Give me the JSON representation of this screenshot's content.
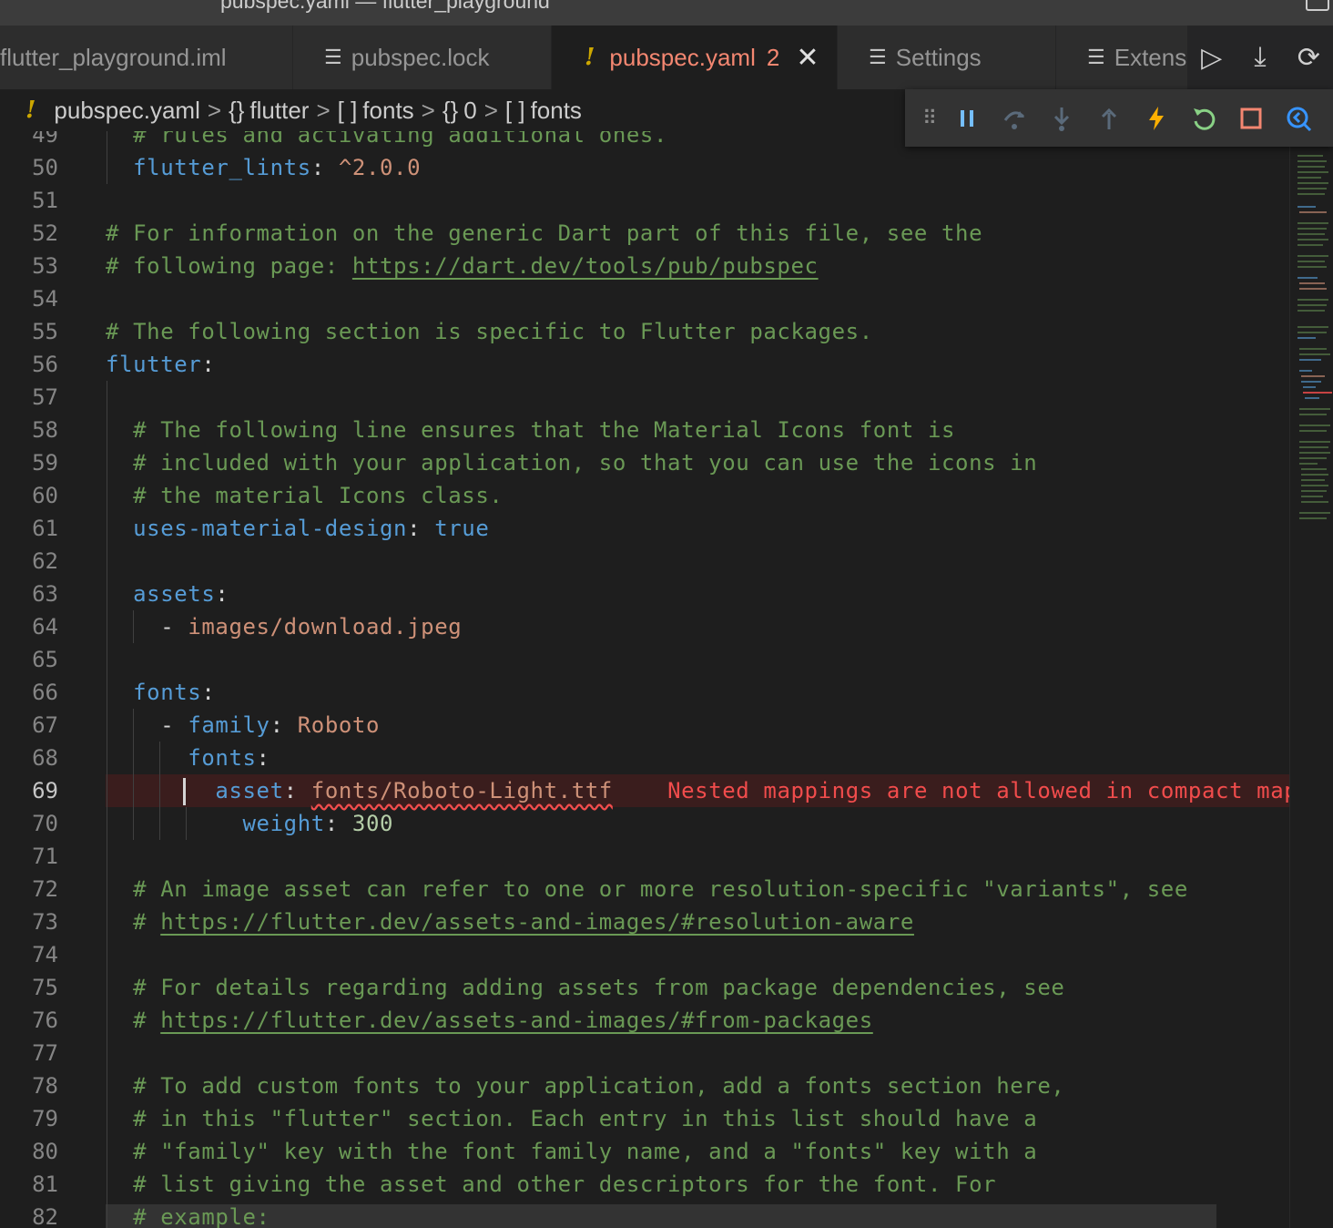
{
  "window": {
    "title": "pubspec.yaml — flutter_playground"
  },
  "tabs": [
    {
      "label": "flutter_playground.iml",
      "active": false
    },
    {
      "label": "pubspec.lock",
      "active": false,
      "icon": "lines-icon"
    },
    {
      "label": "pubspec.yaml",
      "count": "2",
      "active": true,
      "icon": "warning-icon"
    },
    {
      "label": "Settings",
      "active": false,
      "icon": "lines-icon"
    },
    {
      "label": "Extens",
      "active": false,
      "icon": "lines-icon"
    }
  ],
  "tab_actions": [
    "run-icon",
    "download-icon",
    "sync-icon"
  ],
  "breadcrumb": {
    "file": "pubspec.yaml",
    "items": [
      {
        "symbol": "{}",
        "label": "flutter"
      },
      {
        "symbol": "[ ]",
        "label": "fonts"
      },
      {
        "symbol": "{}",
        "label": "0"
      },
      {
        "symbol": "[ ]",
        "label": "fonts"
      }
    ]
  },
  "debug_toolbar": [
    "drag-handle-icon",
    "pause-icon",
    "step-over-icon",
    "step-into-icon",
    "step-out-icon",
    "hot-reload-icon",
    "restart-icon",
    "stop-icon",
    "devtools-icon"
  ],
  "editor": {
    "line_numbers": [
      "49",
      "50",
      "51",
      "52",
      "53",
      "54",
      "55",
      "56",
      "57",
      "58",
      "59",
      "60",
      "61",
      "62",
      "63",
      "64",
      "65",
      "66",
      "67",
      "68",
      "69",
      "70",
      "71",
      "72",
      "73",
      "74",
      "75",
      "76",
      "77",
      "78",
      "79",
      "80",
      "81",
      "82"
    ],
    "current_line": "69",
    "error_message": "Nested mappings are not allowed in compact mappin",
    "lines": {
      "l49": "# rules and activating additional ones.",
      "l50_key": "flutter_lints",
      "l50_val": "^2.0.0",
      "l52": "# For information on the generic Dart part of this file, see the",
      "l53_pre": "# following page: ",
      "l53_link": "https://dart.dev/tools/pub/pubspec",
      "l55": "# The following section is specific to Flutter packages.",
      "l56_key": "flutter",
      "l58": "# The following line ensures that the Material Icons font is",
      "l59": "# included with your application, so that you can use the icons in",
      "l60": "# the material Icons class.",
      "l61_key": "uses-material-design",
      "l61_val": "true",
      "l63_key": "assets",
      "l64_val": "images/download.jpeg",
      "l66_key": "fonts",
      "l67_key": "family",
      "l67_val": "Roboto",
      "l68_key": "fonts",
      "l69_key": "asset",
      "l69_val": "fonts/Roboto-Light.ttf",
      "l70_key": "weight",
      "l70_val": "300",
      "l72": "# An image asset can refer to one or more resolution-specific \"variants\", see",
      "l73_link": "https://flutter.dev/assets-and-images/#resolution-aware",
      "l75": "# For details regarding adding assets from package dependencies, see",
      "l76_link": "https://flutter.dev/assets-and-images/#from-packages",
      "l78": "# To add custom fonts to your application, add a fonts section here,",
      "l79": "# in this \"flutter\" section. Each entry in this list should have a",
      "l80": "# \"family\" key with the font family name, and a \"fonts\" key with a",
      "l81": "# list giving the asset and other descriptors for the font. For",
      "l82": "# example:"
    }
  },
  "colors": {
    "comment": "#6a9955",
    "key": "#569cd6",
    "string": "#ce9178",
    "number": "#b5cea8",
    "error": "#f14c4c",
    "warning": "#cca700"
  }
}
